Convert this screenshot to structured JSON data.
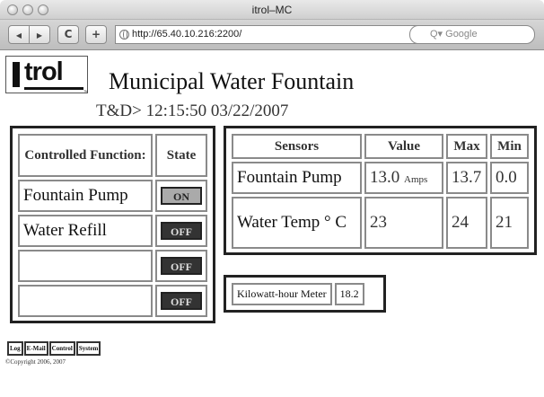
{
  "window": {
    "title": "itrol–MC"
  },
  "toolbar": {
    "back_glyph": "◀",
    "forward_glyph": "▶",
    "reload_glyph": "C",
    "add_glyph": "+",
    "url": "http://65.40.10.216:2200/",
    "search_placeholder": "Q▾ Google"
  },
  "logo": {
    "text": "trol",
    "tm": "™"
  },
  "header": {
    "title": "Municipal Water Fountain",
    "datetime": "T&D> 12:15:50 03/22/2007"
  },
  "controls": {
    "headers": {
      "function": "Controlled Function:",
      "state": "State"
    },
    "rows": [
      {
        "label": "Fountain Pump",
        "state": "ON"
      },
      {
        "label": "Water Refill",
        "state": "OFF"
      },
      {
        "label": "",
        "state": "OFF"
      },
      {
        "label": "",
        "state": "OFF"
      }
    ]
  },
  "sensors": {
    "headers": {
      "sensor": "Sensors",
      "value": "Value",
      "max": "Max",
      "min": "Min"
    },
    "rows": [
      {
        "label": "Fountain Pump",
        "value": "13.0",
        "unit": "Amps",
        "max": "13.7",
        "min": "0.0"
      },
      {
        "label": "Water Temp ° C",
        "value": "23",
        "unit": "",
        "max": "24",
        "min": "21"
      }
    ]
  },
  "kwh": {
    "label": "Kilowatt-hour Meter",
    "value": "18.2"
  },
  "footer": {
    "links": [
      "Log",
      "E-Mail",
      "Control",
      "System"
    ],
    "copyright": "©Copyright 2006, 2007"
  },
  "colors": {
    "on_state": "#aaaaaa",
    "off_state": "#333333",
    "panel_border": "#222222"
  }
}
